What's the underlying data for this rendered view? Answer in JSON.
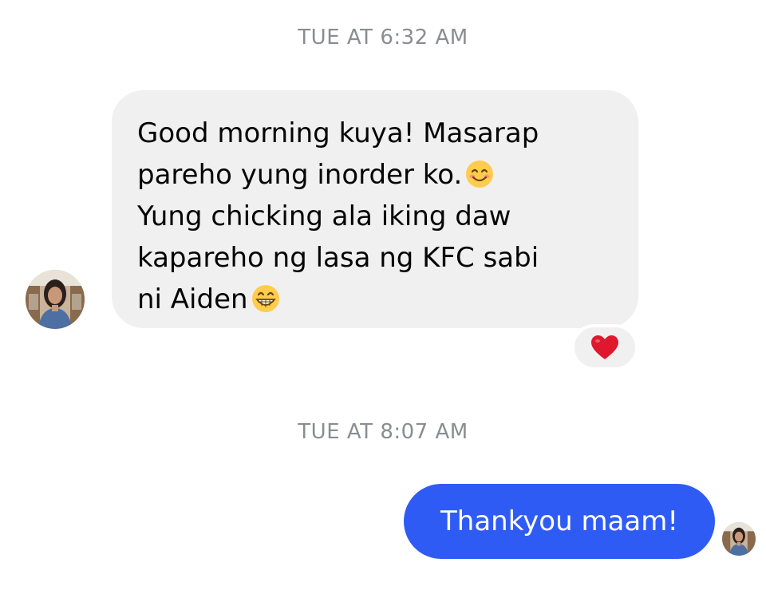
{
  "conversation": {
    "timestamps": [
      "TUE AT 6:32 AM",
      "TUE AT 8:07 AM"
    ],
    "incoming_message": {
      "lines": [
        "Good morning kuya! Masarap",
        "pareho yung inorder ko.",
        "Yung chicking ala iking daw",
        "kapareho ng lasa ng KFC sabi",
        "ni Aiden"
      ],
      "emoji_after_line_2": "smiling-face-icon",
      "emoji_after_line_5": "grinning-face-icon",
      "reaction": "heart-icon"
    },
    "outgoing_message": {
      "text": "Thankyou maam!"
    }
  },
  "colors": {
    "incoming_bubble": "#f0f0f0",
    "outgoing_bubble": "#2f5bf5",
    "timestamp": "#8a8d91",
    "reaction_heart": "#e0182d"
  }
}
